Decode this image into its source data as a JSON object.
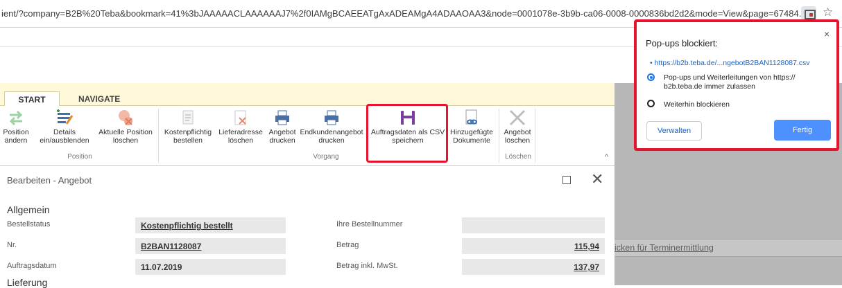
{
  "browser": {
    "url": "ient/?company=B2B%20Teba&bookmark=41%3bJAAAAACLAAAAAAJ7%2f0IAMgBCAEEATgAxADEAMgA4ADAAOAA3&node=0001078e-3b9b-ca06-0008-0000836bd2d2&mode=View&page=67484...",
    "popup_icon": "popup-blocked-icon",
    "star_icon": "star-icon"
  },
  "ribbon": {
    "tabs": [
      "START",
      "NAVIGATE"
    ],
    "buttons": [
      {
        "line1": "Position",
        "line2": "ändern"
      },
      {
        "line1": "Details",
        "line2": "ein/ausblenden"
      },
      {
        "line1": "Aktuelle Position",
        "line2": "löschen"
      },
      {
        "line1": "Kostenpflichtig",
        "line2": "bestellen"
      },
      {
        "line1": "Lieferadresse",
        "line2": "löschen"
      },
      {
        "line1": "Angebot",
        "line2": "drucken"
      },
      {
        "line1": "Endkundenangebot",
        "line2": "drucken"
      },
      {
        "line1": "Auftragsdaten als CSV",
        "line2": "speichern"
      },
      {
        "line1": "Hinzugefügte",
        "line2": "Dokumente"
      },
      {
        "line1": "Angebot",
        "line2": "löschen"
      }
    ],
    "groups": [
      "Position",
      "Vorgang",
      "Löschen"
    ],
    "collapse": "^"
  },
  "dialog": {
    "title": "Bearbeiten - Angebot",
    "section": "Allgemein",
    "section2": "Lieferung",
    "fields": {
      "bestellstatus_label": "Bestellstatus",
      "bestellstatus_value": "Kostenpflichtig bestellt",
      "nr_label": "Nr.",
      "nr_value": "B2BAN1128087",
      "auftragsdatum_label": "Auftragsdatum",
      "auftragsdatum_value": "11.07.2019",
      "bestellnummer_label": "Ihre Bestellnummer",
      "bestellnummer_value": "",
      "betrag_label": "Betrag",
      "betrag_value": "115,94",
      "betrag_mwst_label": "Betrag inkl. MwSt.",
      "betrag_mwst_value": "137,97"
    }
  },
  "background": {
    "link_text": "icken für Terminermittlung"
  },
  "popup": {
    "title": "Pop-ups blockiert:",
    "link": "https://b2b.teba.de/...ngebotB2BAN1128087.csv",
    "option_allow": "Pop-ups und Weiterleitungen von https://",
    "option_allow_2": "b2b.teba.de immer zulassen",
    "option_block": "Weiterhin blockieren",
    "btn_manage": "Verwalten",
    "btn_done": "Fertig",
    "close": "×"
  },
  "colors": {
    "highlight_red": "#e5132e",
    "ribbon_yellow": "#fff8d9",
    "chrome_blue": "#4d90fe"
  }
}
